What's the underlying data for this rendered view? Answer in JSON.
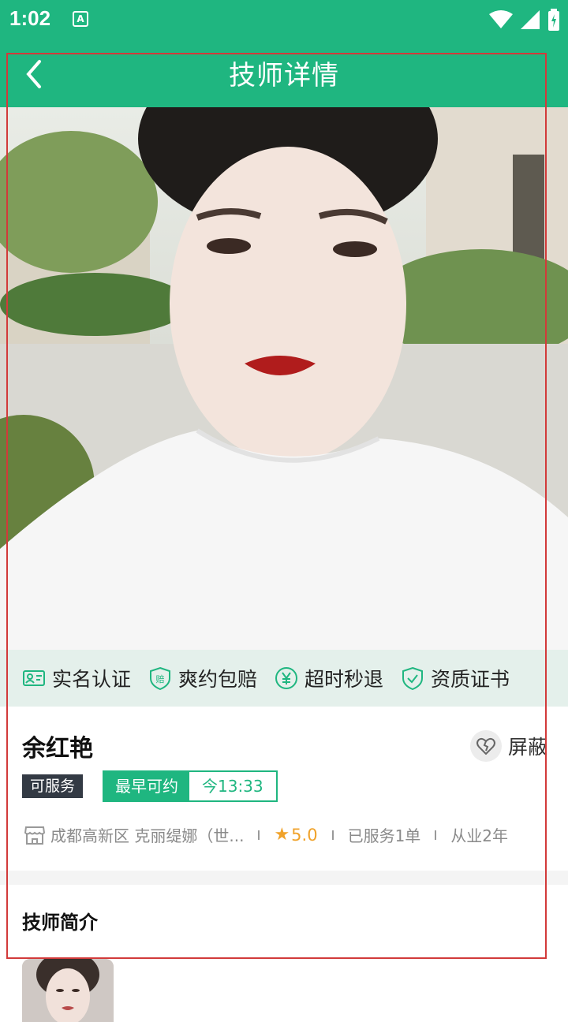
{
  "status": {
    "time": "1:02",
    "app_icon_letter": "A"
  },
  "header": {
    "title": "技师详情"
  },
  "guarantees": [
    {
      "icon": "id-card-icon",
      "label": "实名认证"
    },
    {
      "icon": "compensation-shield-icon",
      "label": "爽约包赔"
    },
    {
      "icon": "yen-refund-icon",
      "label": "超时秒退"
    },
    {
      "icon": "check-shield-icon",
      "label": "资质证书"
    }
  ],
  "technician": {
    "name": "余红艳",
    "block_label": "屏蔽",
    "status_badge": "可服务",
    "earliest_label": "最早可约",
    "earliest_time": "今13:33",
    "store": "成都高新区 克丽缇娜（世...",
    "rating": "5.0",
    "served": "已服务1单",
    "experience": "从业2年"
  },
  "intro": {
    "title": "技师简介"
  },
  "colors": {
    "brand": "#1fb680",
    "rating": "#f0a22a"
  }
}
